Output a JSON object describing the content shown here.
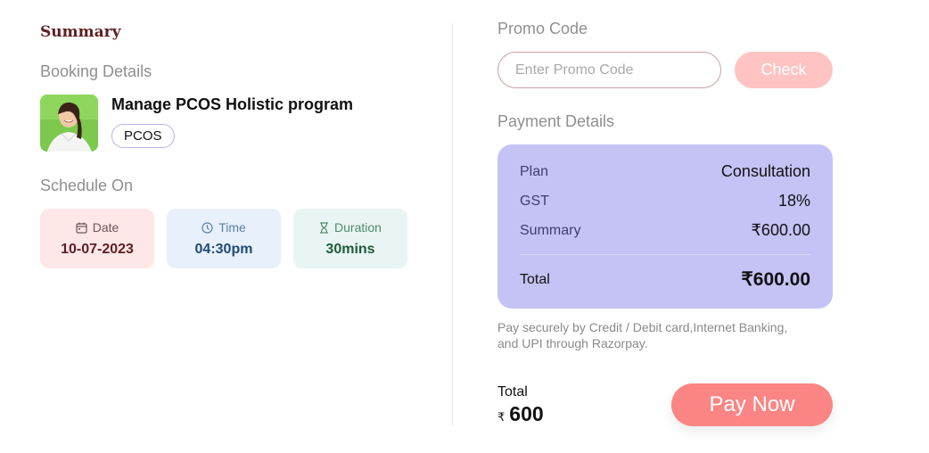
{
  "summary_title": "Summary",
  "booking": {
    "section_label": "Booking Details",
    "program_name": "Manage PCOS Holistic program",
    "tag": "PCOS"
  },
  "schedule": {
    "section_label": "Schedule On",
    "date": {
      "label": "Date",
      "value": "10-07-2023",
      "icon": "calendar-icon"
    },
    "time": {
      "label": "Time",
      "value": "04:30pm",
      "icon": "clock-icon"
    },
    "duration": {
      "label": "Duration",
      "value": "30mins",
      "icon": "hourglass-icon"
    }
  },
  "promo": {
    "section_label": "Promo Code",
    "placeholder": "Enter Promo Code",
    "button_label": "Check"
  },
  "payment": {
    "section_label": "Payment Details",
    "rows": [
      {
        "key": "Plan",
        "value": "Consultation"
      },
      {
        "key": "GST",
        "value": "18%"
      },
      {
        "key": "Summary",
        "value": "₹600.00"
      }
    ],
    "total_key": "Total",
    "total_value": "₹600.00",
    "note": "Pay securely by Credit / Debit card,Internet Banking, and UPI through Razorpay."
  },
  "footer": {
    "total_label": "Total",
    "currency_symbol": "₹",
    "total_amount": "600",
    "pay_button_label": "Pay Now"
  },
  "colors": {
    "brand_title": "#5e1f22",
    "payment_card": "#c5c3f5",
    "pay_button": "#fb8585",
    "check_button": "#ffc3c3"
  }
}
